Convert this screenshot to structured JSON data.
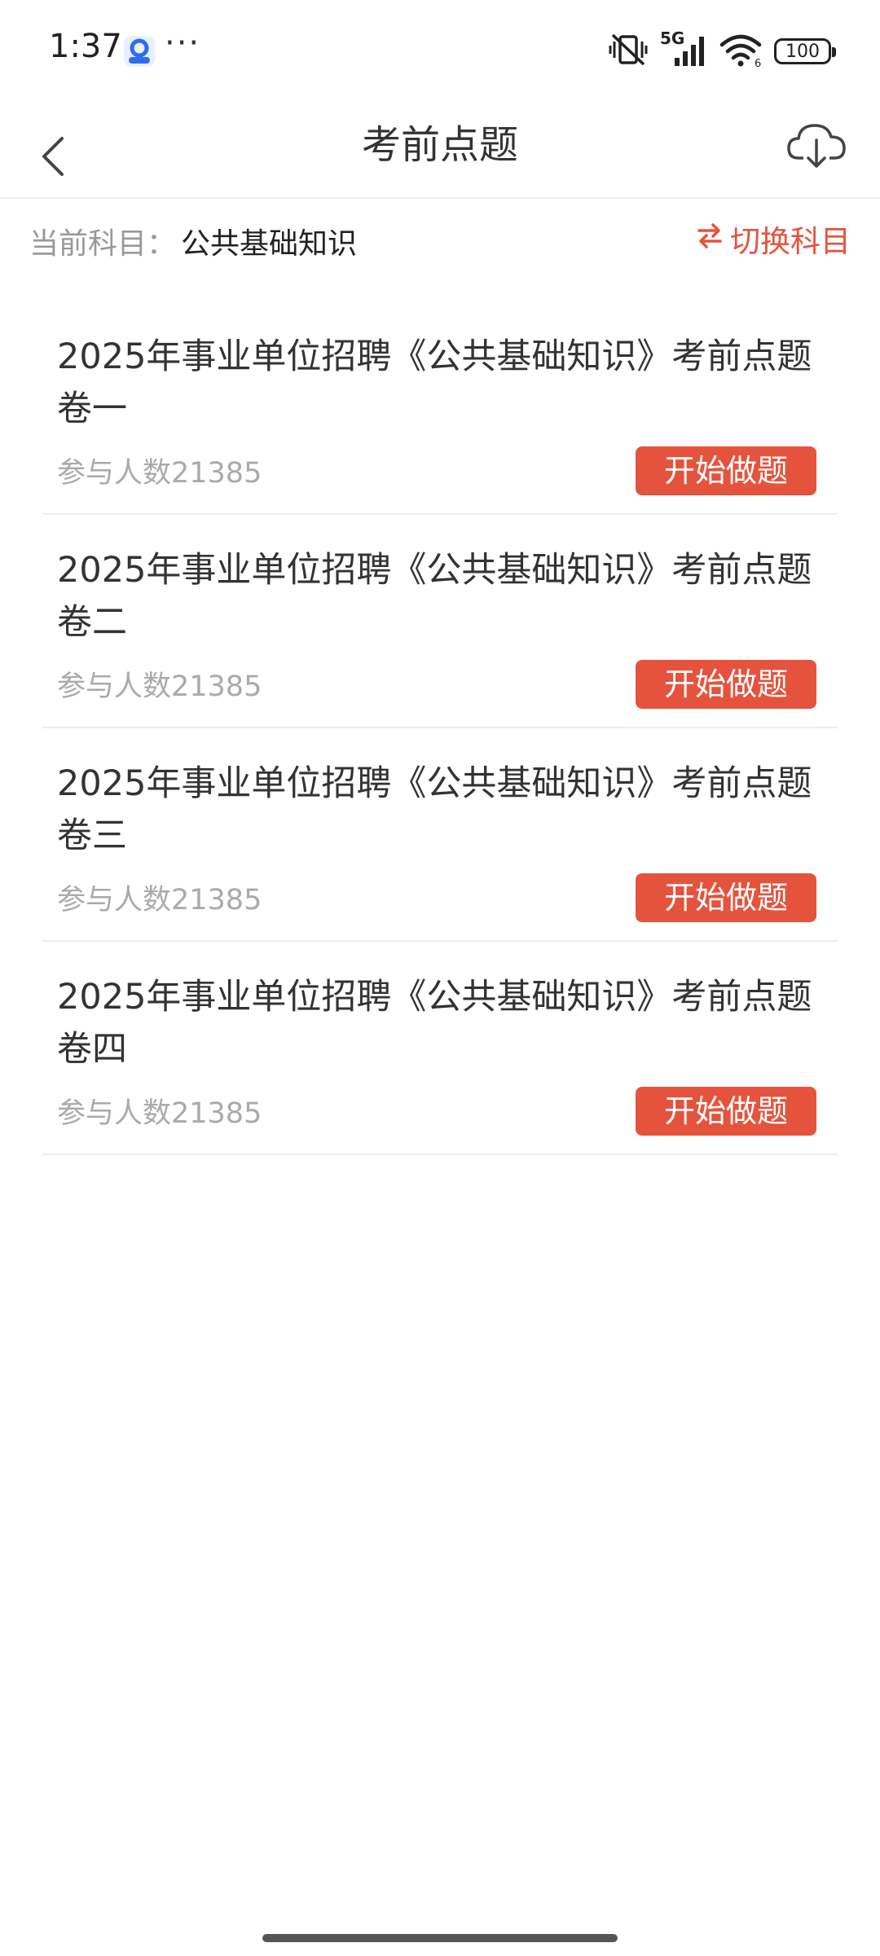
{
  "status_bar": {
    "time": "1:37",
    "more": "···",
    "network": "5G",
    "battery": "100",
    "icons": [
      "app-icon",
      "vibrate-off-icon",
      "signal-icon",
      "wifi-icon",
      "battery-icon"
    ]
  },
  "nav": {
    "title": "考前点题",
    "back_icon": "chevron-left-icon",
    "download_icon": "cloud-download-icon"
  },
  "subject": {
    "label": "当前科目：",
    "value": "公共基础知识",
    "switch_label": "切换科目",
    "switch_icon": "swap-arrows-icon"
  },
  "papers": [
    {
      "title": "2025年事业单位招聘《公共基础知识》考前点题卷一",
      "count": "参与人数21385",
      "button": "开始做题"
    },
    {
      "title": "2025年事业单位招聘《公共基础知识》考前点题卷二",
      "count": "参与人数21385",
      "button": "开始做题"
    },
    {
      "title": "2025年事业单位招聘《公共基础知识》考前点题卷三",
      "count": "参与人数21385",
      "button": "开始做题"
    },
    {
      "title": "2025年事业单位招聘《公共基础知识》考前点题卷四",
      "count": "参与人数21385",
      "button": "开始做题"
    }
  ],
  "colors": {
    "accent": "#e5533d",
    "text_primary": "#333333",
    "text_secondary": "#aaaaaa",
    "divider": "#eeeeee"
  }
}
